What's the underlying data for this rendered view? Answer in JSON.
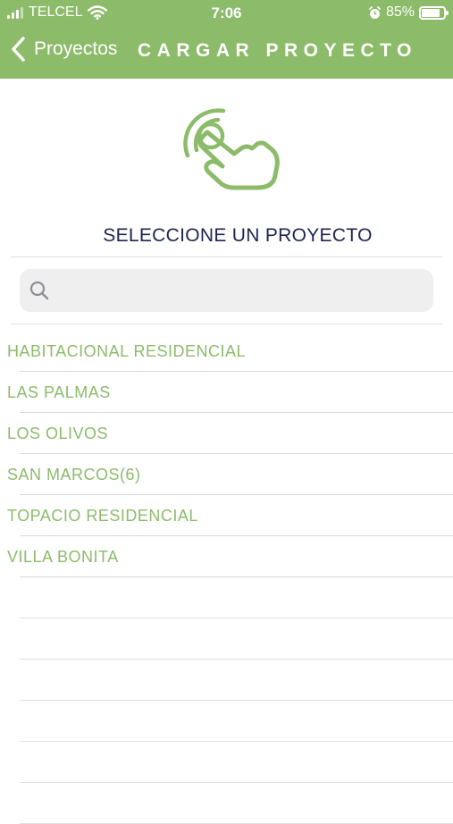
{
  "status_bar": {
    "carrier": "TELCEL",
    "time": "7:06",
    "battery_percent": "85%",
    "battery_level": 0.85,
    "icons": [
      "signal-icon",
      "wifi-icon",
      "alarm-icon",
      "battery-icon"
    ]
  },
  "nav": {
    "back_label": "Proyectos",
    "title": "CARGAR PROYECTO"
  },
  "hero_icon": "touch-hand-icon",
  "heading": "SELECCIONE UN PROYECTO",
  "search": {
    "placeholder": "",
    "value": ""
  },
  "projects": [
    "HABITACIONAL RESIDENCIAL",
    "LAS PALMAS",
    "LOS OLIVOS",
    "SAN MARCOS(6)",
    "TOPACIO RESIDENCIAL",
    "VILLA BONITA"
  ],
  "colors": {
    "accent": "#8cbb6a",
    "heading": "#1d2450",
    "search_bg": "#efeff0"
  }
}
